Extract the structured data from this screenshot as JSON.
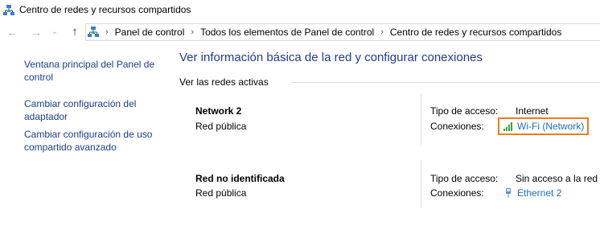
{
  "window": {
    "title": "Centro de redes y recursos compartidos"
  },
  "nav": {
    "back_glyph": "←",
    "forward_glyph": "→",
    "recent_glyph": "⌄",
    "up_glyph": "↑",
    "breadcrumbs": [
      "Panel de control",
      "Todos los elementos de Panel de control",
      "Centro de redes y recursos compartidos"
    ]
  },
  "sidebar": {
    "links": [
      "Ventana principal del Panel de control",
      "Cambiar configuración del adaptador",
      "Cambiar configuración de uso compartido avanzado"
    ]
  },
  "main": {
    "title": "Ver información básica de la red y configurar conexiones",
    "active_networks_label": "Ver las redes activas",
    "networks": [
      {
        "name": "Network  2",
        "type": "Red pública",
        "access_label": "Tipo de acceso:",
        "access_value": "Internet",
        "connections_label": "Conexiones:",
        "connection_name": "Wi-Fi (Network)",
        "connection_icon": "wifi-signal-icon"
      },
      {
        "name": "Red no identificada",
        "type": "Red pública",
        "access_label": "Tipo de acceso:",
        "access_value": "Sin acceso a la red",
        "connections_label": "Conexiones:",
        "connection_name": "Ethernet 2",
        "connection_icon": "ethernet-icon"
      }
    ]
  },
  "colors": {
    "title_blue": "#1e3d92",
    "link_blue": "#1a3e8c",
    "connection_link": "#1a6fc4",
    "highlight_border": "#f07c1c"
  }
}
